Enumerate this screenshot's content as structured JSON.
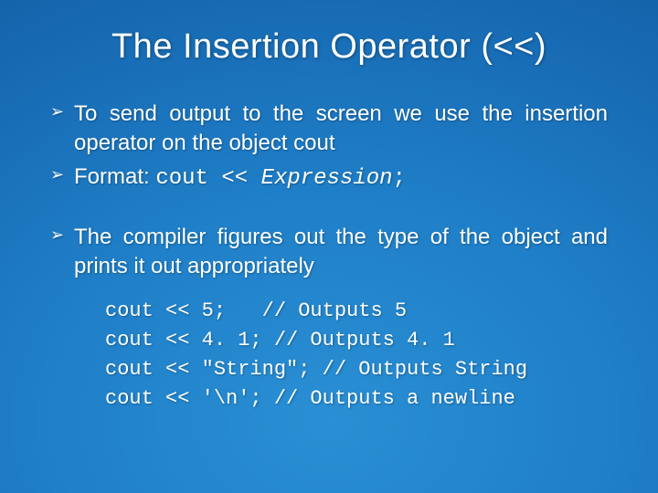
{
  "title": "The Insertion Operator (<<)",
  "bullets": {
    "b1": "To send output to the screen we use the insertion operator on the object cout",
    "b2_prefix": "Format: ",
    "b2_code": "cout << ",
    "b2_expr": "Expression",
    "b2_semi": ";",
    "b3": "The compiler figures out the type of the object and prints it out appropriately"
  },
  "code": {
    "l1": "cout << 5;   // Outputs 5",
    "l2": "cout << 4. 1; // Outputs 4. 1",
    "l3": "cout << \"String\"; // Outputs String",
    "l4": "cout << '\\n'; // Outputs a newline"
  }
}
